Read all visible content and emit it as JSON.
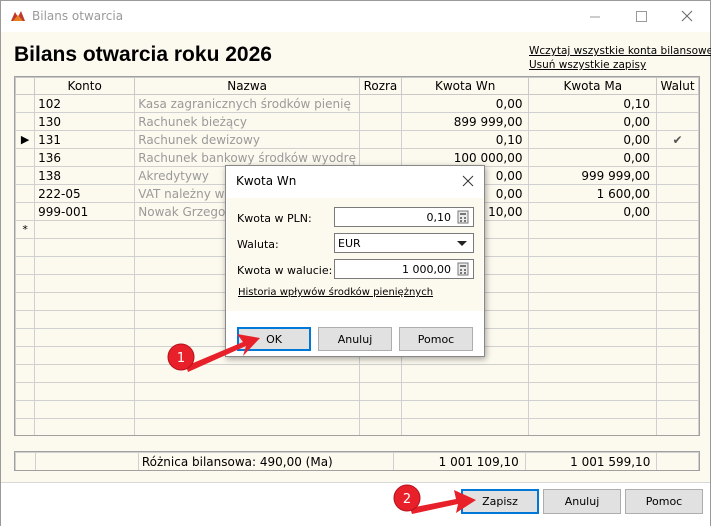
{
  "window": {
    "title": "Bilans otwarcia"
  },
  "header": {
    "page_title": "Bilans otwarcia roku 2026",
    "link_load_all": "Wczytaj wszystkie konta bilansowe",
    "link_delete_all": "Usuń wszystkie zapisy"
  },
  "table": {
    "columns": [
      "Konto",
      "Nazwa",
      "Rozra",
      "Kwota Wn",
      "Kwota Ma",
      "Walut"
    ],
    "rows": [
      {
        "konto": "102",
        "nazwa": "Kasa zagranicznych środków pienię",
        "rozra": "",
        "wn": "0,00",
        "ma": "0,10",
        "walut": ""
      },
      {
        "konto": "130",
        "nazwa": "Rachunek bieżący",
        "rozra": "",
        "wn": "899 999,00",
        "ma": "0,00",
        "walut": ""
      },
      {
        "konto": "131",
        "nazwa": "Rachunek dewizowy",
        "rozra": "",
        "wn": "0,10",
        "ma": "0,00",
        "walut": "✔"
      },
      {
        "konto": "136",
        "nazwa": "Rachunek bankowy środków wyodrę",
        "rozra": "",
        "wn": "100 000,00",
        "ma": "0,00",
        "walut": ""
      },
      {
        "konto": "138",
        "nazwa": "Akredytywy",
        "rozra": "",
        "wn": "0,00",
        "ma": "999 999,00",
        "walut": ""
      },
      {
        "konto": "222-05",
        "nazwa": "VAT należny w",
        "rozra": "",
        "wn": "0,00",
        "ma": "1 600,00",
        "walut": ""
      },
      {
        "konto": "999-001",
        "nazwa": "Nowak Grzego",
        "rozra": "",
        "wn": "10,00",
        "ma": "0,00",
        "walut": ""
      }
    ],
    "current_row_marker": "▶",
    "new_row_marker": "*"
  },
  "summary": {
    "label": "Różnica bilansowa: 490,00 (Ma)",
    "total_wn": "1 001 109,10",
    "total_ma": "1 001 599,10"
  },
  "footer": {
    "save_label": "Zapisz",
    "cancel_label": "Anuluj",
    "help_label": "Pomoc"
  },
  "dialog": {
    "title": "Kwota Wn",
    "pln_label": "Kwota w PLN:",
    "pln_value": "0,10",
    "currency_label": "Waluta:",
    "currency_value": "EUR",
    "foreign_label": "Kwota w walucie:",
    "foreign_value": "1 000,00",
    "history_link": "Historia wpływów środków pieniężnych",
    "ok_label": "OK",
    "cancel_label": "Anuluj",
    "help_label": "Pomoc"
  },
  "annotations": {
    "badge_1": "1",
    "badge_2": "2",
    "color": "#e8202a"
  }
}
